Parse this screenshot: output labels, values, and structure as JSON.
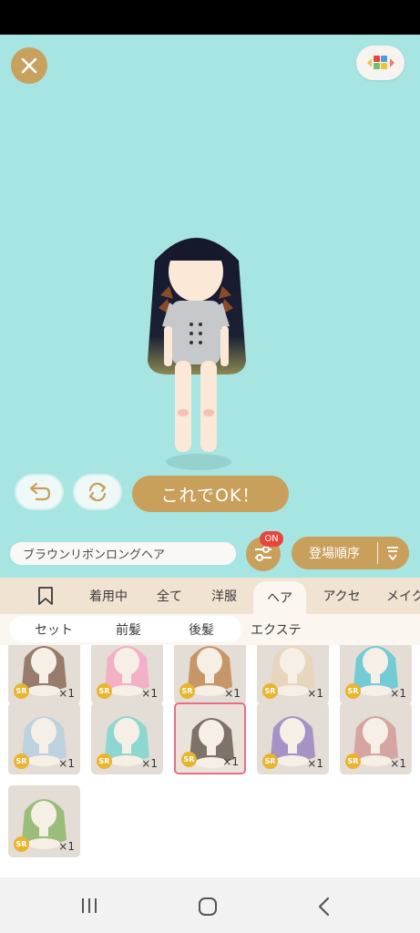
{
  "stage": {
    "close_icon": "close-icon",
    "palette_icon": "color-palette-icon",
    "undo_icon": "undo-icon",
    "rotate_icon": "rotate-icon",
    "ok_label": "これでOK！"
  },
  "filter_bar": {
    "item_name": "ブラウンリボンロングヘア",
    "filter_icon": "sliders-icon",
    "filter_badge": "ON",
    "sort_label": "登場順序",
    "sort_icon": "sort-down-icon"
  },
  "tabs": {
    "bookmark_icon": "bookmark-icon",
    "items": [
      "着用中",
      "全て",
      "洋服",
      "ヘア",
      "アクセ",
      "メイク"
    ],
    "active": "ヘア"
  },
  "subtabs": {
    "items": [
      "セット",
      "前髪",
      "後髪",
      "エクステ"
    ],
    "active": "後髪"
  },
  "grid": {
    "items": [
      {
        "rarity": "SR",
        "count": "×1",
        "hair_color": "#8a6a58",
        "selected": false
      },
      {
        "rarity": "SR",
        "count": "×1",
        "hair_color": "#f4a9c1",
        "selected": false
      },
      {
        "rarity": "SR",
        "count": "×1",
        "hair_color": "#c28a55",
        "selected": false
      },
      {
        "rarity": "SR",
        "count": "×1",
        "hair_color": "#e9d4ba",
        "selected": false
      },
      {
        "rarity": "SR",
        "count": "×1",
        "hair_color": "#5fc8d6",
        "selected": false
      },
      {
        "rarity": "SR",
        "count": "×1",
        "hair_color": "#b7cfe0",
        "selected": false
      },
      {
        "rarity": "SR",
        "count": "×1",
        "hair_color": "#7fd6cf",
        "selected": false
      },
      {
        "rarity": "SR",
        "count": "×1",
        "hair_color": "#6b5f55",
        "selected": true
      },
      {
        "rarity": "SR",
        "count": "×1",
        "hair_color": "#9a86c2",
        "selected": false
      },
      {
        "rarity": "SR",
        "count": "×1",
        "hair_color": "#d29a9a",
        "selected": false
      },
      {
        "rarity": "SR",
        "count": "×1",
        "hair_color": "#8db86a",
        "selected": false
      }
    ]
  },
  "nav": {
    "recents_icon": "recents-icon",
    "home_icon": "home-icon",
    "back_icon": "back-icon"
  },
  "colors": {
    "stage_bg": "#a6e5e2",
    "accent_gold": "#c8a05c",
    "badge_red": "#e8453c",
    "tab_bg": "#f0e3d2",
    "selected_border": "#ea6d86"
  }
}
